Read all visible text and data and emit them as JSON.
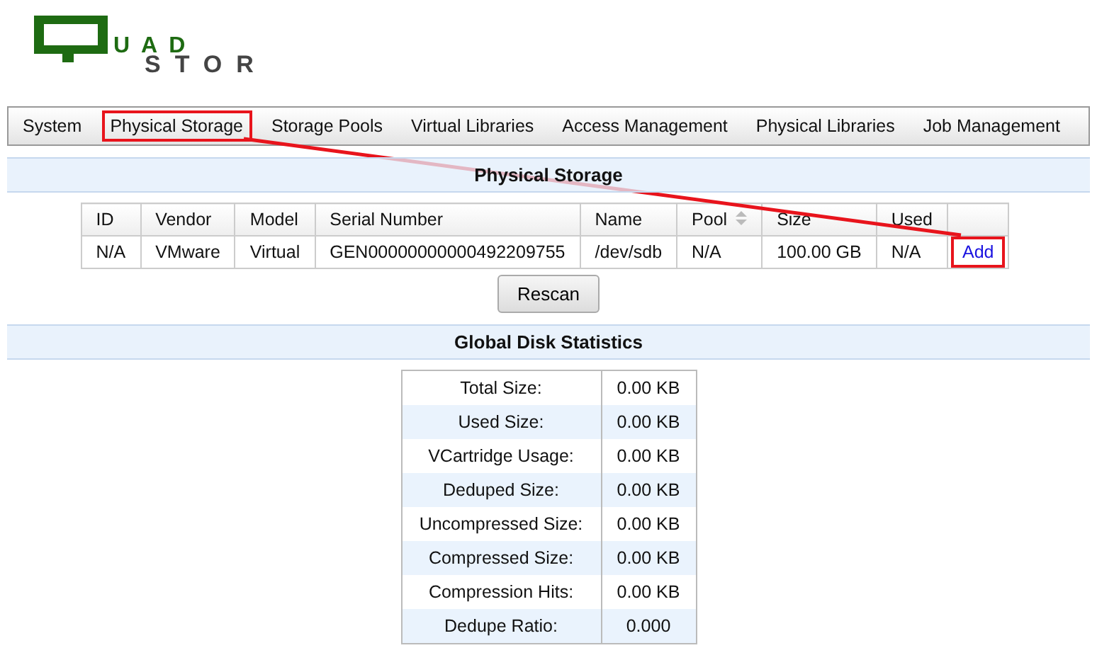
{
  "logo": {
    "line_1": "UAD",
    "line_2": "STOR"
  },
  "tabs": [
    {
      "label": "System",
      "highlighted": false
    },
    {
      "label": "Physical Storage",
      "highlighted": true
    },
    {
      "label": "Storage Pools",
      "highlighted": false
    },
    {
      "label": "Virtual Libraries",
      "highlighted": false
    },
    {
      "label": "Access Management",
      "highlighted": false
    },
    {
      "label": "Physical Libraries",
      "highlighted": false
    },
    {
      "label": "Job Management",
      "highlighted": false
    }
  ],
  "physical_storage": {
    "title": "Physical Storage",
    "columns": [
      {
        "label": "ID",
        "sortable": false
      },
      {
        "label": "Vendor",
        "sortable": false
      },
      {
        "label": "Model",
        "sortable": false
      },
      {
        "label": "Serial Number",
        "sortable": false
      },
      {
        "label": "Name",
        "sortable": false
      },
      {
        "label": "Pool",
        "sortable": true
      },
      {
        "label": "Size",
        "sortable": false
      },
      {
        "label": "Used",
        "sortable": false
      }
    ],
    "rows": [
      {
        "cells": [
          "N/A",
          "VMware",
          "Virtual",
          "GEN00000000000492209755",
          "/dev/sdb",
          "N/A",
          "100.00 GB",
          "N/A"
        ],
        "action": {
          "label": "Add",
          "highlighted": true
        }
      }
    ],
    "rescan_button": "Rescan"
  },
  "global_disk_statistics": {
    "title": "Global Disk Statistics",
    "rows": [
      {
        "label": "Total Size:",
        "value": "0.00 KB"
      },
      {
        "label": "Used Size:",
        "value": "0.00 KB"
      },
      {
        "label": "VCartridge Usage:",
        "value": "0.00 KB"
      },
      {
        "label": "Deduped Size:",
        "value": "0.00 KB"
      },
      {
        "label": "Uncompressed Size:",
        "value": "0.00 KB"
      },
      {
        "label": "Compressed Size:",
        "value": "0.00 KB"
      },
      {
        "label": "Compression Hits:",
        "value": "0.00 KB"
      },
      {
        "label": "Dedupe Ratio:",
        "value": "0.000"
      }
    ]
  }
}
